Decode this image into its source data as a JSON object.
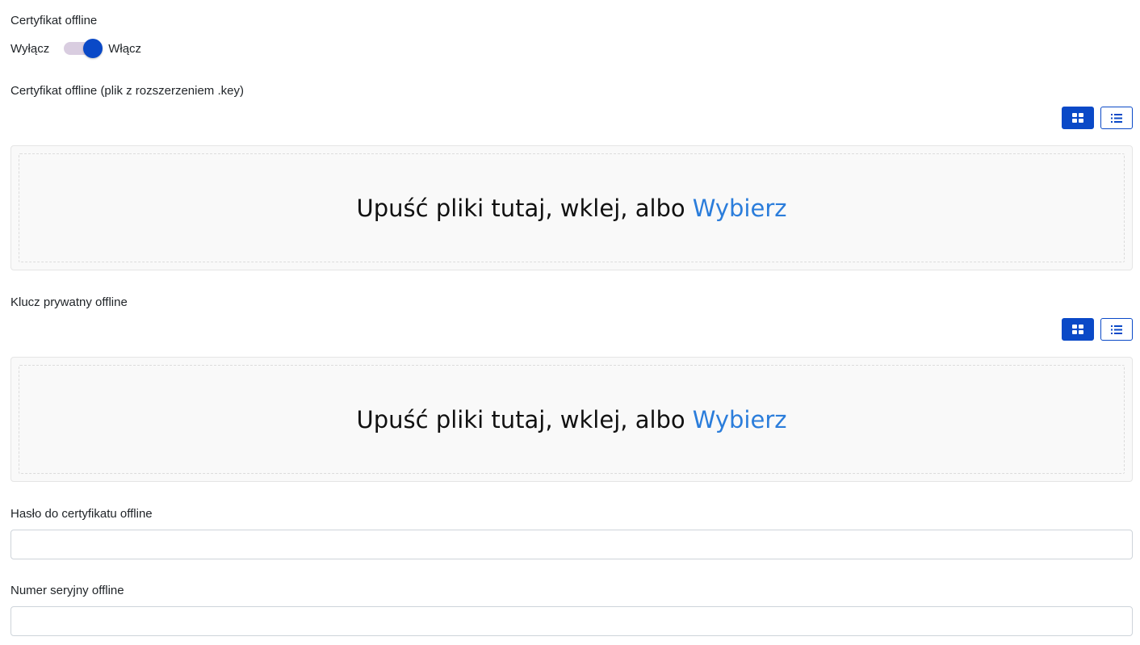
{
  "offline_certificate": {
    "label": "Certyfikat offline",
    "toggle": {
      "off_label": "Wyłącz",
      "on_label": "Włącz",
      "state": "on"
    }
  },
  "certificate_file": {
    "label": "Certyfikat offline (plik z rozszerzeniem .key)",
    "view_buttons": [
      {
        "icon": "grid-icon",
        "active": true
      },
      {
        "icon": "list-icon",
        "active": false
      }
    ],
    "dropzone": {
      "text": "Upuść pliki tutaj, wklej, albo",
      "link": "Wybierz"
    }
  },
  "private_key": {
    "label": "Klucz prywatny offline",
    "view_buttons": [
      {
        "icon": "grid-icon",
        "active": true
      },
      {
        "icon": "list-icon",
        "active": false
      }
    ],
    "dropzone": {
      "text": "Upuść pliki tutaj, wklej, albo",
      "link": "Wybierz"
    }
  },
  "password": {
    "label": "Hasło do certyfikatu offline",
    "value": ""
  },
  "serial_number": {
    "label": "Numer seryjny offline",
    "value": ""
  },
  "colors": {
    "primary": "#0a49c7",
    "link": "#2b7ddb",
    "switch_track": "#d9cde0",
    "dropzone_bg": "#f9f9f9"
  }
}
